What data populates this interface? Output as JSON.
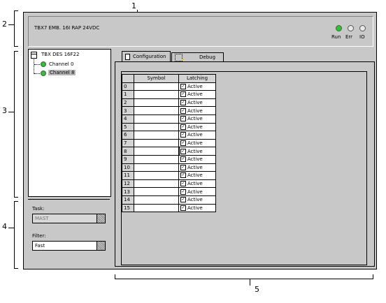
{
  "callouts": [
    "1",
    "2",
    "3",
    "4",
    "5"
  ],
  "header": {
    "module_title": "TBX7 EMB. 16I RAP 24VDC",
    "leds": [
      {
        "label": "Run",
        "color": "#22cc22"
      },
      {
        "label": "Err",
        "color": "#e0e0e0"
      },
      {
        "label": "IO",
        "color": "#e0e0e0"
      }
    ]
  },
  "tree": {
    "root_label": "TBX DES 16F22",
    "channels": [
      {
        "label": "Channel 0",
        "color": "#22cc22",
        "selected": false
      },
      {
        "label": "Channel 8",
        "color": "#22cc22",
        "selected": true
      }
    ]
  },
  "task": {
    "label": "Task:",
    "value": "MAST"
  },
  "filter": {
    "label": "Filter:",
    "value": "Fast"
  },
  "tabs": [
    {
      "label": "Configuration",
      "active": true
    },
    {
      "label": "Debug",
      "active": false
    }
  ],
  "table": {
    "col_symbol": "Symbol",
    "col_latching": "Latching",
    "rows": [
      {
        "num": "0",
        "latch": "Active"
      },
      {
        "num": "1",
        "latch": "Active"
      },
      {
        "num": "2",
        "latch": "Active"
      },
      {
        "num": "3",
        "latch": "Active"
      },
      {
        "num": "4",
        "latch": "Active"
      },
      {
        "num": "5",
        "latch": "Active"
      },
      {
        "num": "6",
        "latch": "Active"
      },
      {
        "num": "7",
        "latch": "Active"
      },
      {
        "num": "8",
        "latch": "Active"
      },
      {
        "num": "9",
        "latch": "Active"
      },
      {
        "num": "10",
        "latch": "Active"
      },
      {
        "num": "11",
        "latch": "Active"
      },
      {
        "num": "12",
        "latch": "Active"
      },
      {
        "num": "13",
        "latch": "Active"
      },
      {
        "num": "14",
        "latch": "Active"
      },
      {
        "num": "15",
        "latch": "Active"
      }
    ]
  }
}
